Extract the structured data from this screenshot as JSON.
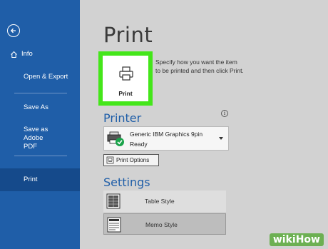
{
  "sidebar": {
    "items": [
      {
        "label": "Info"
      },
      {
        "label": "Open & Export"
      },
      {
        "label": "Save As"
      },
      {
        "label": "Save as Adobe PDF"
      },
      {
        "label": "Print"
      }
    ],
    "active": "Print"
  },
  "main": {
    "title": "Print",
    "print_button_label": "Print",
    "description": "Specify how you want the item to be printed and then click Print.",
    "printer_heading": "Printer",
    "printer": {
      "name": "Generic IBM Graphics 9pin",
      "status": "Ready"
    },
    "print_options_label": "Print Options",
    "settings_heading": "Settings",
    "styles": [
      {
        "label": "Table Style",
        "selected": false
      },
      {
        "label": "Memo Style",
        "selected": true
      }
    ]
  },
  "watermark": "wikiHow",
  "colors": {
    "sidebar": "#1f5ea8",
    "highlight": "#44e61a",
    "status_ok": "#1aa34a"
  }
}
